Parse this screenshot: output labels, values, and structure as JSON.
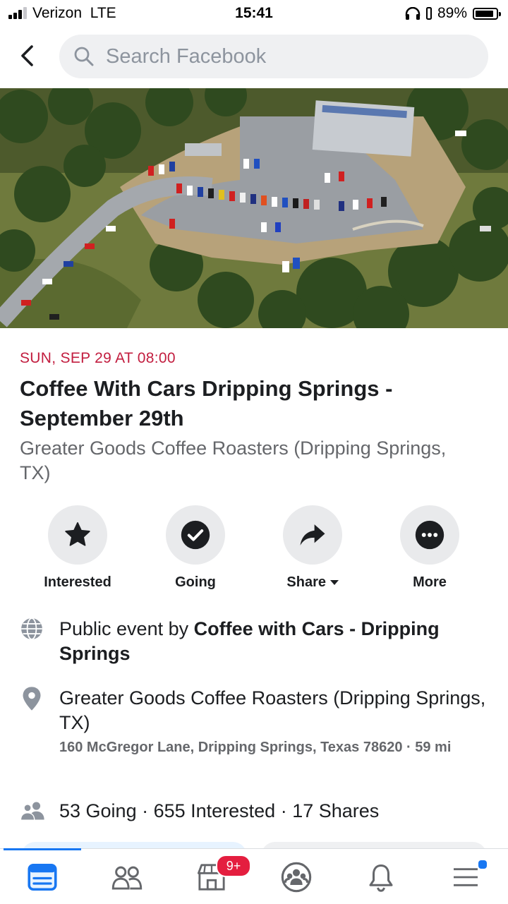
{
  "status_bar": {
    "carrier": "Verizon",
    "network": "LTE",
    "time": "15:41",
    "battery_percent": "89%",
    "battery_level": 0.89
  },
  "search": {
    "placeholder": "Search Facebook"
  },
  "event": {
    "date": "SUN, SEP 29 AT 08:00",
    "title": "Coffee With Cars Dripping Springs - September 29th",
    "venue": "Greater Goods Coffee Roasters (Dripping Springs, TX)"
  },
  "actions": [
    {
      "label": "Interested",
      "icon": "star-icon"
    },
    {
      "label": "Going",
      "icon": "check-circle-icon"
    },
    {
      "label": "Share",
      "icon": "share-arrow-icon"
    },
    {
      "label": "More",
      "icon": "more-dots-icon"
    }
  ],
  "details": {
    "host_prefix": "Public event by ",
    "host_name": "Coffee with Cars - Dripping Springs",
    "location_name": "Greater Goods Coffee Roasters (Dripping Springs, TX)",
    "address": "160 McGregor Lane, Dripping Springs, Texas 78620 · 59 mi",
    "stats": "53 Going · 655 Interested · 17 Shares"
  },
  "tabbar": {
    "marketplace_badge": "9+",
    "active_color": "#1877f2",
    "badge_color": "#e41e3f"
  },
  "colors": {
    "date_accent": "#c21d3f",
    "secondary_text": "#65676b",
    "icon_gray": "#8d949e"
  }
}
